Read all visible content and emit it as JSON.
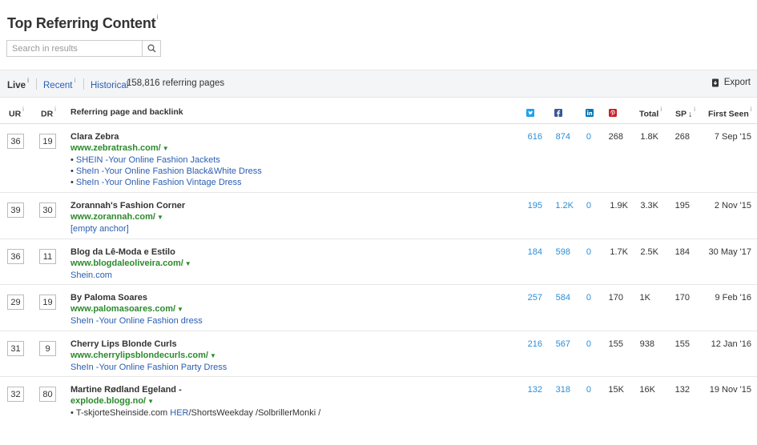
{
  "title": "Top Referring Content",
  "info_glyph": "i",
  "search": {
    "placeholder": "Search in results"
  },
  "toolbar": {
    "live": "Live",
    "recent": "Recent",
    "historical": "Historical",
    "count": "158,816 referring pages",
    "export": "Export"
  },
  "columns": {
    "ur": "UR",
    "dr": "DR",
    "page": "Referring page and backlink",
    "total": "Total",
    "sp": "SP",
    "first_seen": "First Seen"
  },
  "icons": {
    "twitter_color": "#1da1f2",
    "facebook_color": "#3b5998",
    "linkedin_color": "#0077b5",
    "pinterest_color": "#cb2027"
  },
  "rows": [
    {
      "ur": "36",
      "dr": "19",
      "title": "Clara Zebra",
      "url": "www.zebratrash.com/",
      "anchors": [
        {
          "bullet": true,
          "text": "SHEIN -Your Online Fashion Jackets"
        },
        {
          "bullet": true,
          "text": "SheIn -Your Online Fashion Black&White Dress"
        },
        {
          "bullet": true,
          "text": "SheIn -Your Online Fashion Vintage Dress"
        }
      ],
      "tw": "616",
      "fb": "874",
      "li": "0",
      "pin": "268",
      "total": "1.8K",
      "sp": "268",
      "first_seen": "7 Sep '15"
    },
    {
      "ur": "39",
      "dr": "30",
      "title": "Zorannah's Fashion Corner",
      "url": "www.zorannah.com/",
      "anchors": [
        {
          "bullet": false,
          "text": "[empty anchor]"
        }
      ],
      "tw": "195",
      "fb": "1.2K",
      "li": "0",
      "pin": "1.9K",
      "total": "3.3K",
      "sp": "195",
      "first_seen": "2 Nov '15"
    },
    {
      "ur": "36",
      "dr": "11",
      "title": "Blog da Lê-Moda e Estilo",
      "url": "www.blogdaleoliveira.com/",
      "anchors": [
        {
          "bullet": false,
          "text": "Shein.com"
        }
      ],
      "tw": "184",
      "fb": "598",
      "li": "0",
      "pin": "1.7K",
      "total": "2.5K",
      "sp": "184",
      "first_seen": "30 May '17"
    },
    {
      "ur": "29",
      "dr": "19",
      "title": "By Paloma Soares",
      "url": "www.palomasoares.com/",
      "anchors": [
        {
          "bullet": false,
          "text": "SheIn -Your Online Fashion dress"
        }
      ],
      "tw": "257",
      "fb": "584",
      "li": "0",
      "pin": "170",
      "total": "1K",
      "sp": "170",
      "first_seen": "9 Feb '16"
    },
    {
      "ur": "31",
      "dr": "9",
      "title": "Cherry Lips Blonde Curls",
      "url": "www.cherrylipsblondecurls.com/",
      "anchors": [
        {
          "bullet": false,
          "text": "SheIn -Your Online Fashion Party Dress"
        }
      ],
      "tw": "216",
      "fb": "567",
      "li": "0",
      "pin": "155",
      "total": "938",
      "sp": "155",
      "first_seen": "12 Jan '16"
    },
    {
      "ur": "32",
      "dr": "80",
      "title": "Martine Rødland Egeland -",
      "url": "explode.blogg.no/",
      "anchors": [
        {
          "bullet": true,
          "pre": "T-skjorteSheinside.com",
          "text": "HER",
          "post": "/ShortsWeekday /SolbrillerMonki /"
        }
      ],
      "tw": "132",
      "fb": "318",
      "li": "0",
      "pin": "15K",
      "total": "16K",
      "sp": "132",
      "first_seen": "19 Nov '15"
    }
  ]
}
